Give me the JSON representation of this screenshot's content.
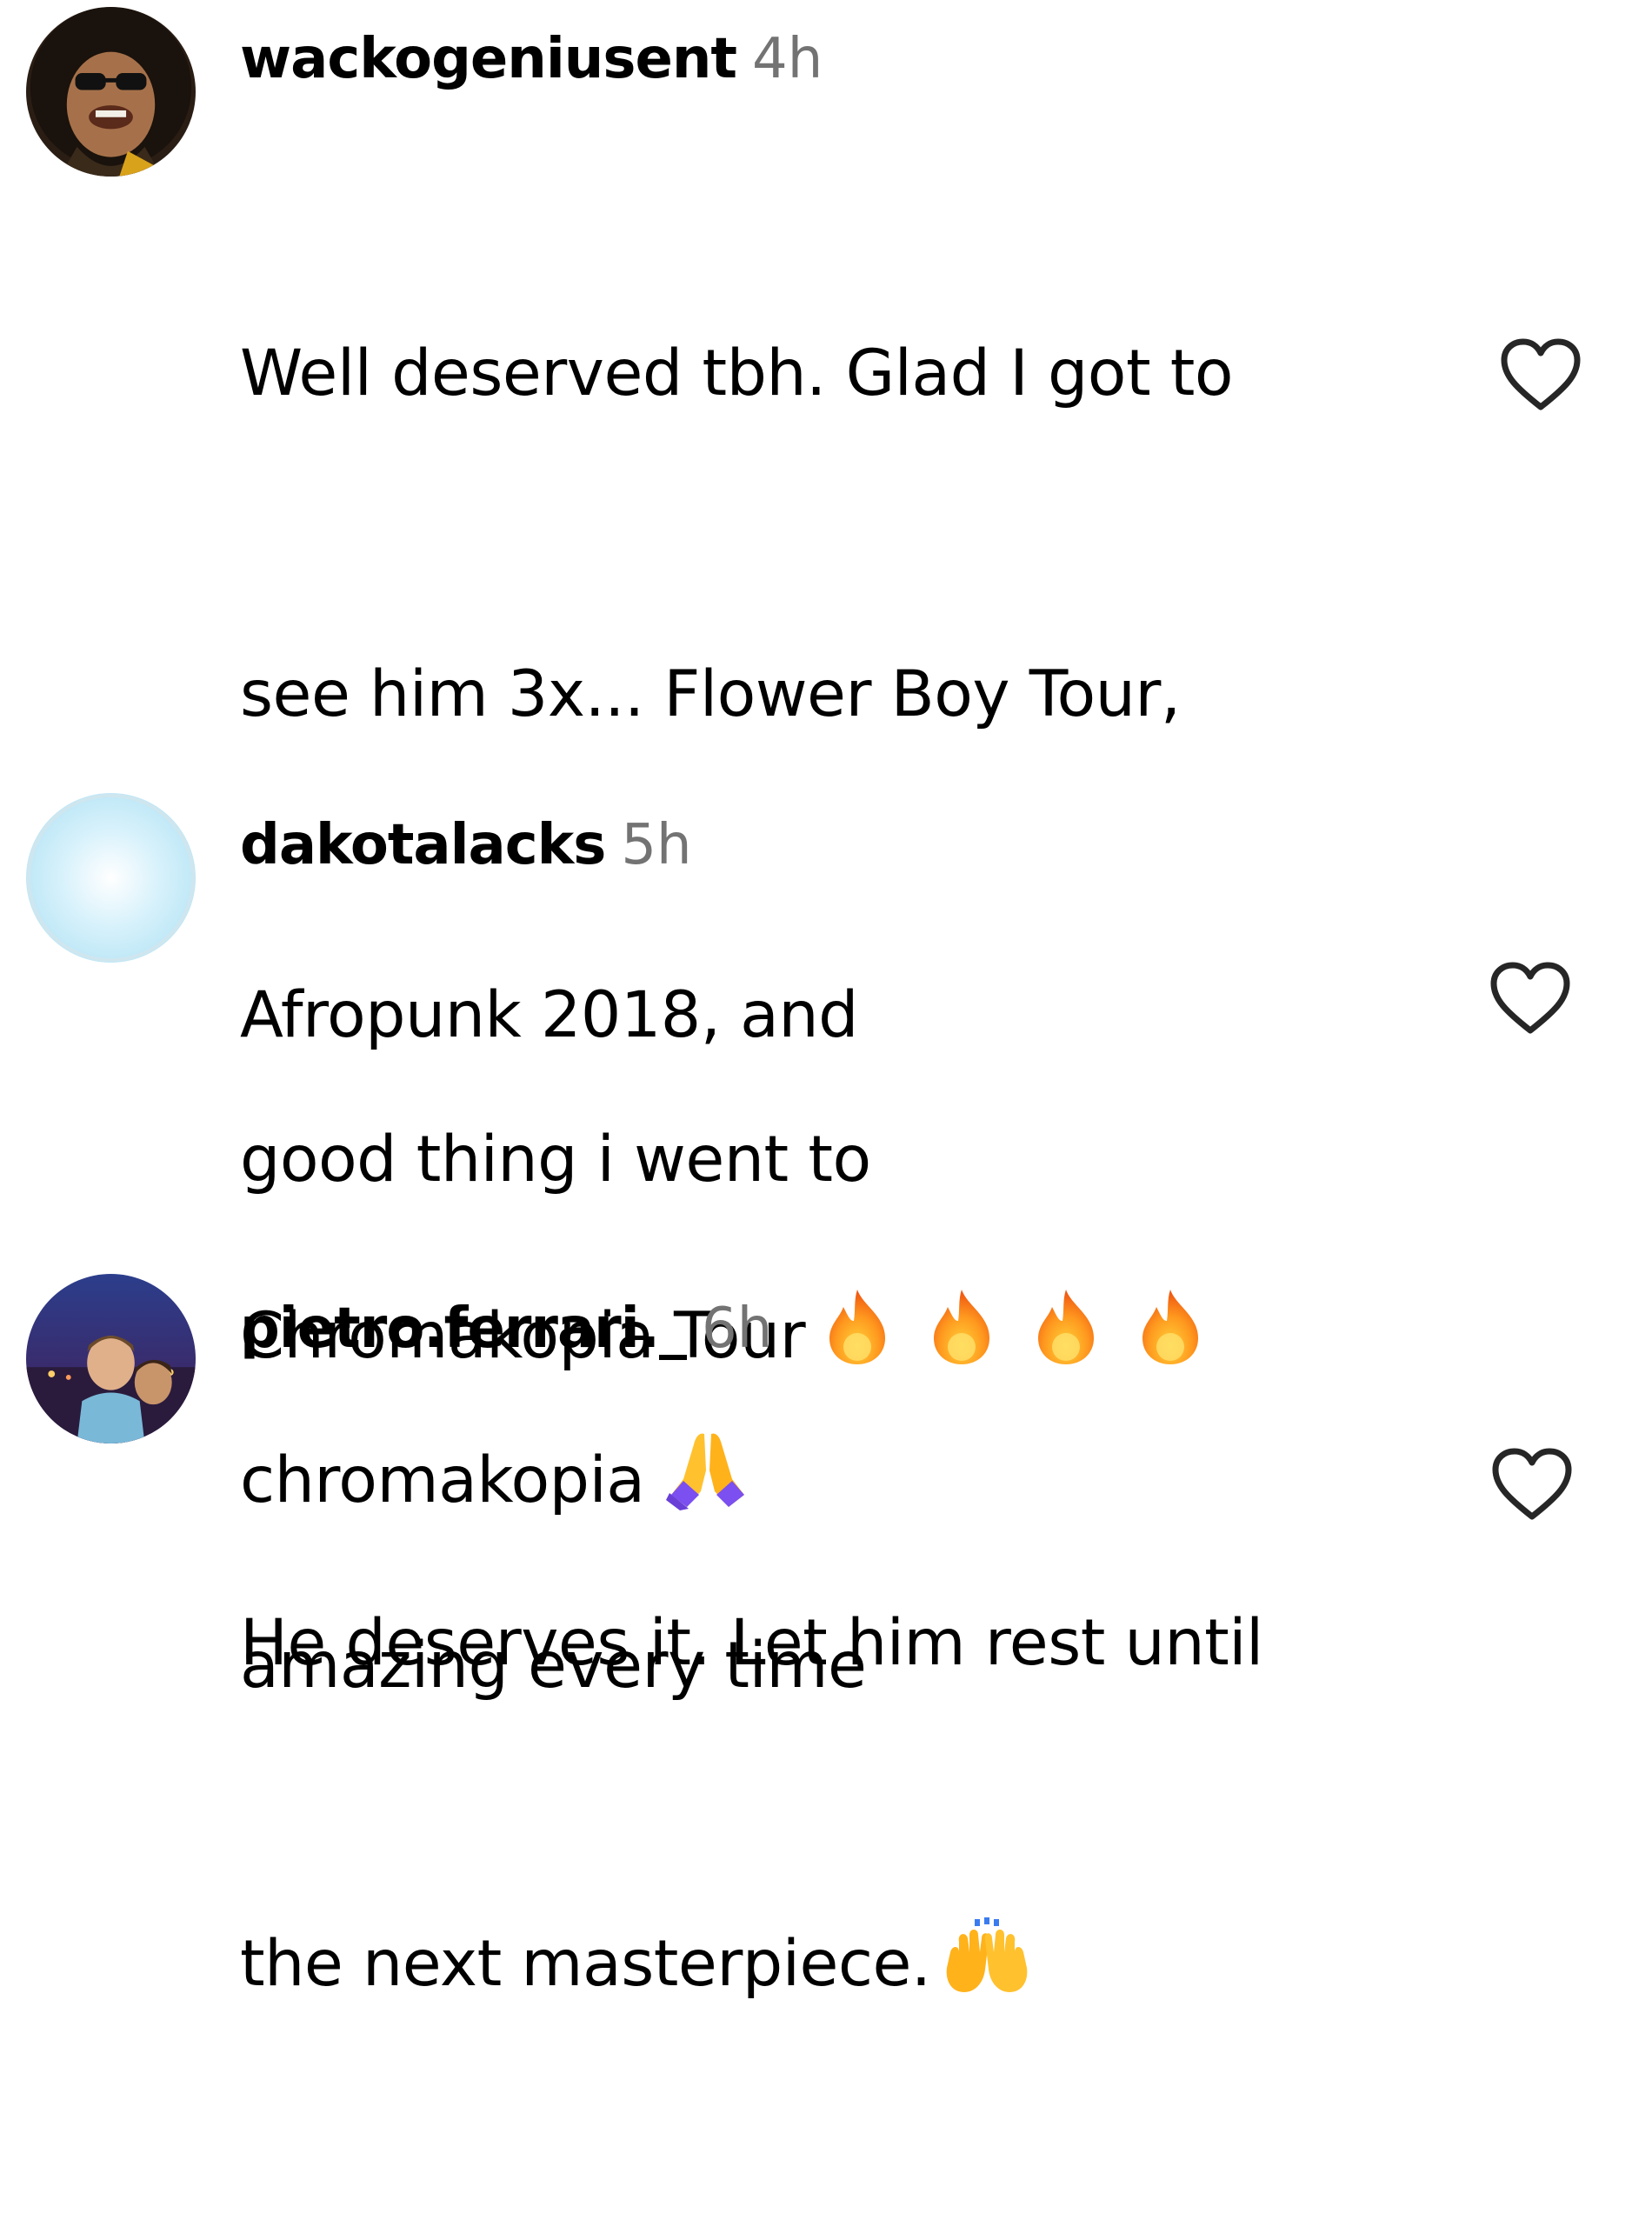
{
  "comments": [
    {
      "username": "wackogeniusent",
      "time": "4h",
      "lines": [
        "Well deserved tbh. Glad I got to",
        "see him 3x... Flower Boy Tour,",
        "Afropunk 2018, and",
        "Chromakopia Tour",
        "amazing every time"
      ],
      "emojis": [
        "fire-emoji",
        "fire-emoji",
        "fire-emoji",
        "fire-emoji"
      ],
      "like_icon": "heart-outline-icon"
    },
    {
      "username": "dakotalacks",
      "time": "5h",
      "lines": [
        "good thing i went to",
        "chromakopia"
      ],
      "emojis": [
        "folded-hands-emoji"
      ],
      "like_icon": "heart-outline-icon"
    },
    {
      "username": "pietro.ferrari._",
      "time": "6h",
      "lines": [
        "He deserves it. Let him rest until",
        "the next masterpiece."
      ],
      "emojis": [
        "raising-hands-emoji"
      ],
      "like_icon": "heart-outline-icon"
    }
  ],
  "colors": {
    "timestamp": "#737373",
    "text": "#000000",
    "heart_outline": "#262626"
  }
}
